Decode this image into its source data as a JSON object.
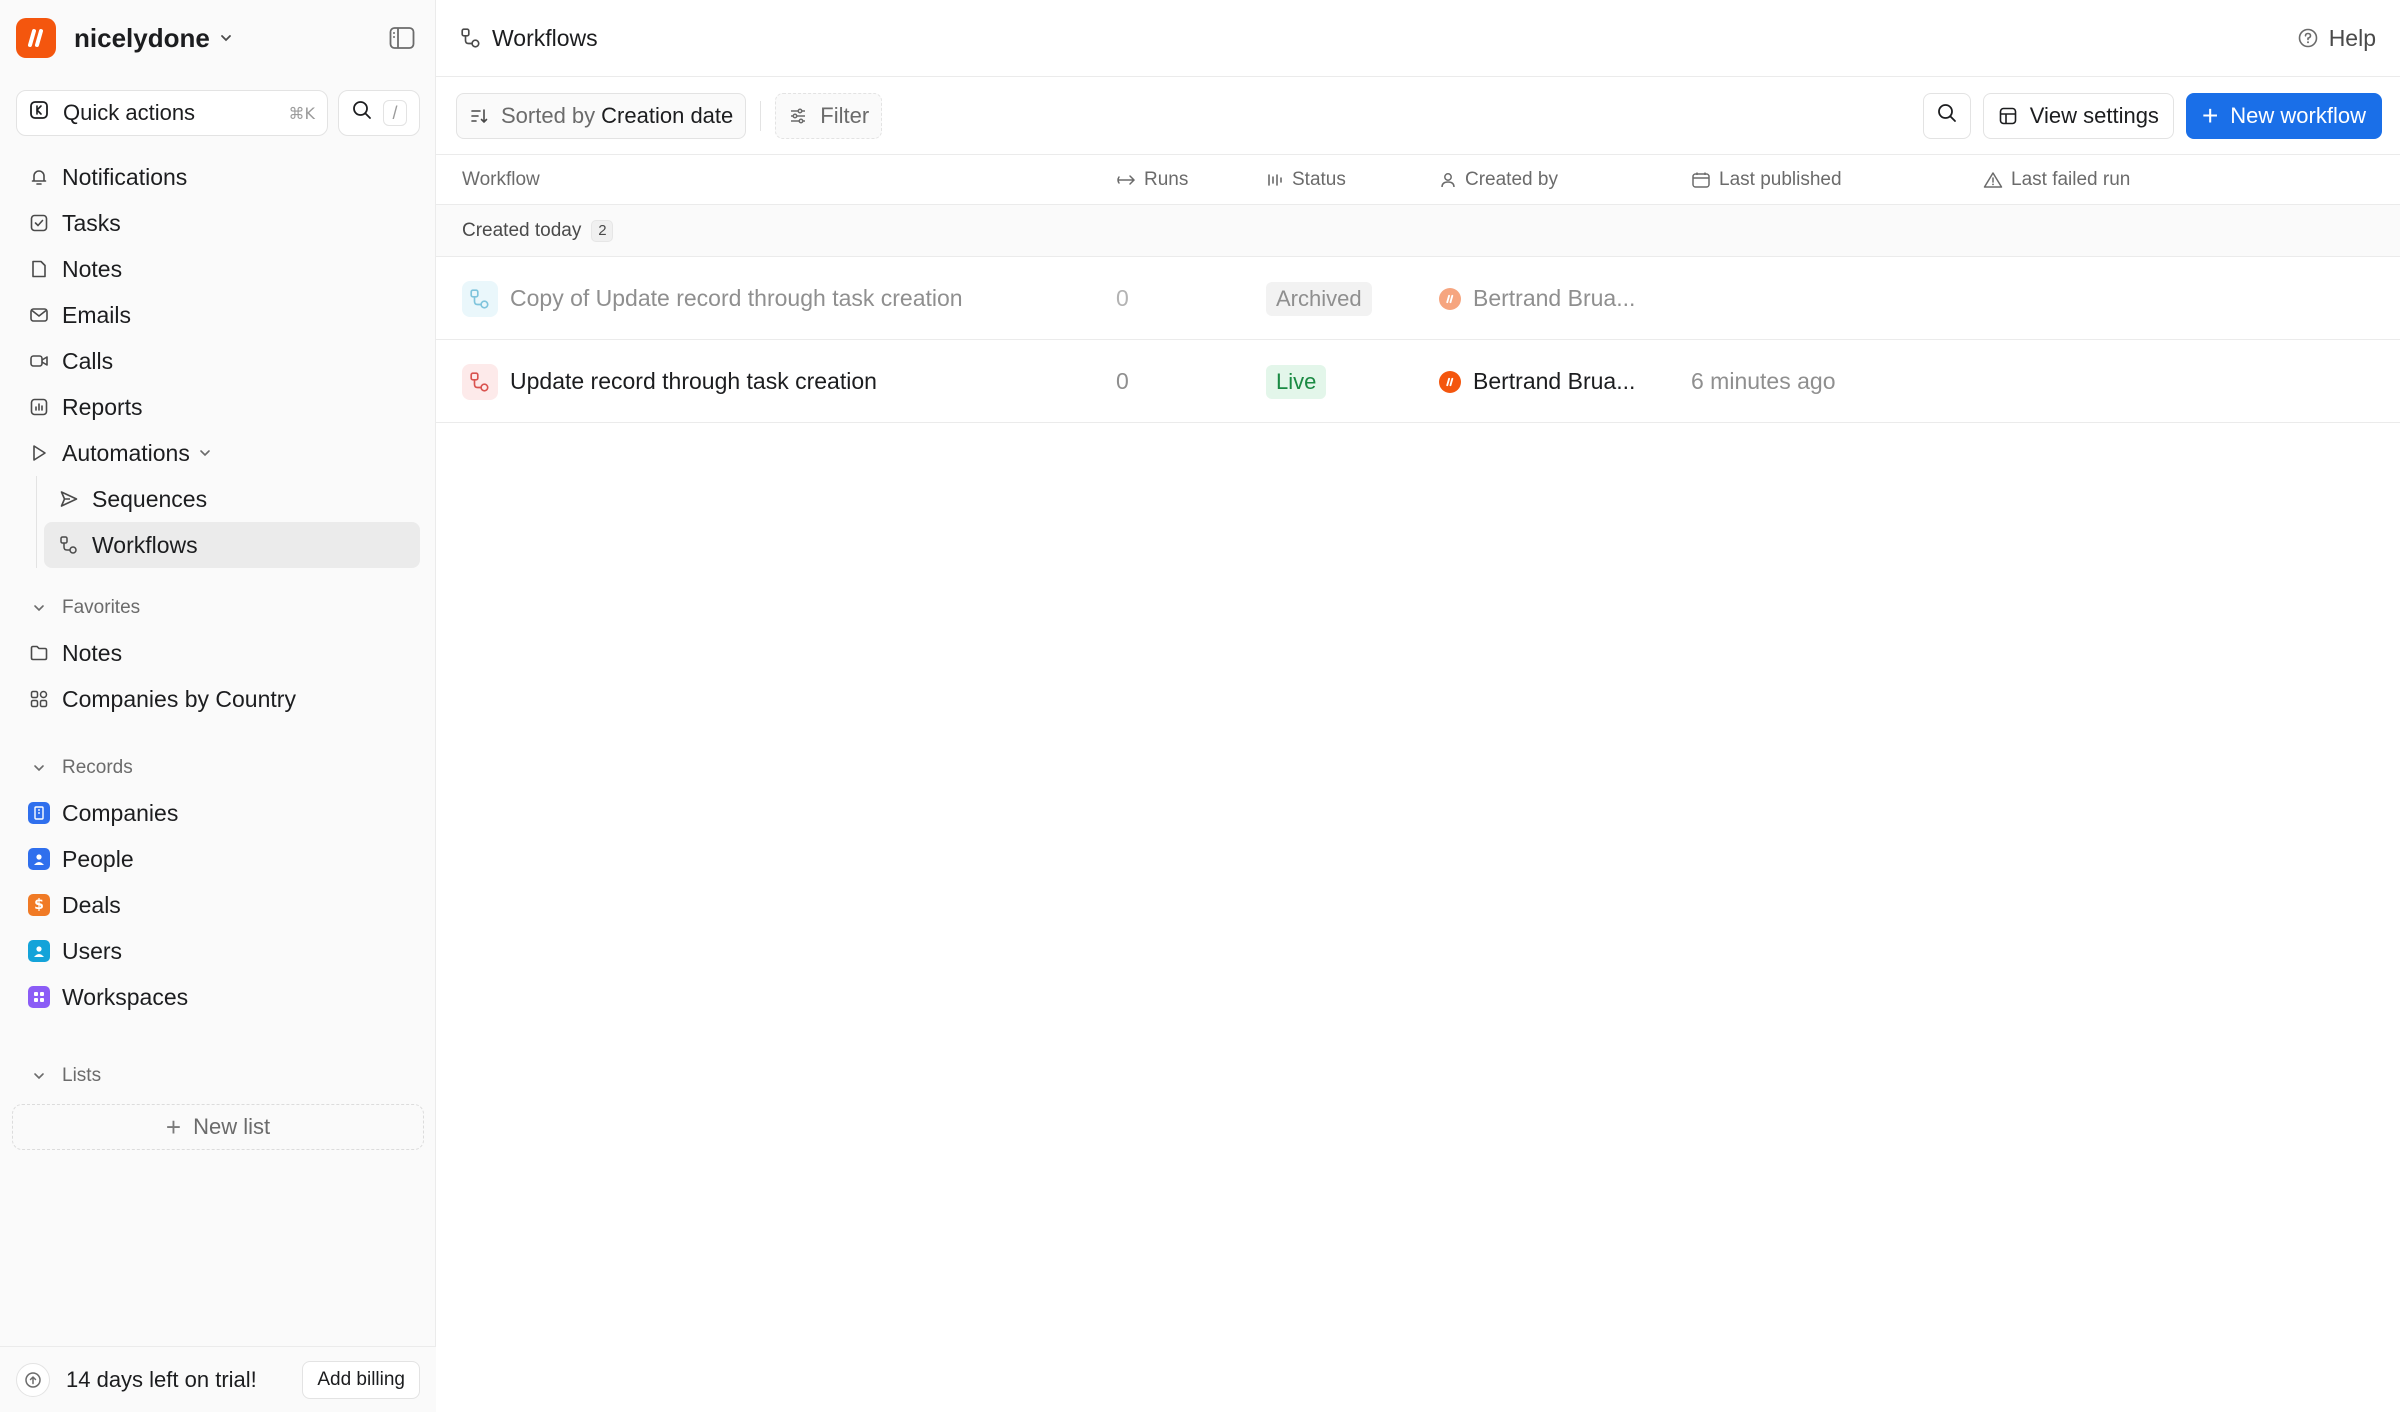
{
  "colors": {
    "accent": "#1a6fe8",
    "brand": "#f4560e",
    "live_bg": "#e3f6ea",
    "live_text": "#1a8a43",
    "archived_bg": "#f2f2f2"
  },
  "workspace": {
    "name": "nicelydone"
  },
  "quick_actions": {
    "label": "Quick actions",
    "shortcut": "⌘K",
    "search_shortcut": "/"
  },
  "nav": {
    "notifications": "Notifications",
    "tasks": "Tasks",
    "notes": "Notes",
    "emails": "Emails",
    "calls": "Calls",
    "reports": "Reports",
    "automations": "Automations",
    "sequences": "Sequences",
    "workflows": "Workflows"
  },
  "favorites": {
    "title": "Favorites",
    "items": [
      "Notes",
      "Companies by Country"
    ]
  },
  "records": {
    "title": "Records",
    "items": [
      "Companies",
      "People",
      "Deals",
      "Users",
      "Workspaces"
    ]
  },
  "lists": {
    "title": "Lists",
    "new_list": "New list"
  },
  "trial": {
    "text": "14 days left on trial!",
    "button": "Add billing"
  },
  "header": {
    "title": "Workflows",
    "help": "Help"
  },
  "toolbar": {
    "sort_prefix": "Sorted by",
    "sort_field": "Creation date",
    "filter": "Filter",
    "view_settings": "View settings",
    "new_workflow": "New workflow"
  },
  "columns": {
    "workflow": "Workflow",
    "runs": "Runs",
    "status": "Status",
    "created_by": "Created by",
    "last_published": "Last published",
    "last_failed_run": "Last failed run"
  },
  "group": {
    "label": "Created today",
    "count": "2"
  },
  "rows": [
    {
      "name": "Copy of Update record through task creation",
      "runs": "0",
      "status": "Archived",
      "created_by": "Bertrand Brua...",
      "last_published": "",
      "last_failed_run": ""
    },
    {
      "name": "Update record through task creation",
      "runs": "0",
      "status": "Live",
      "created_by": "Bertrand Brua...",
      "last_published": "6 minutes ago",
      "last_failed_run": ""
    }
  ]
}
